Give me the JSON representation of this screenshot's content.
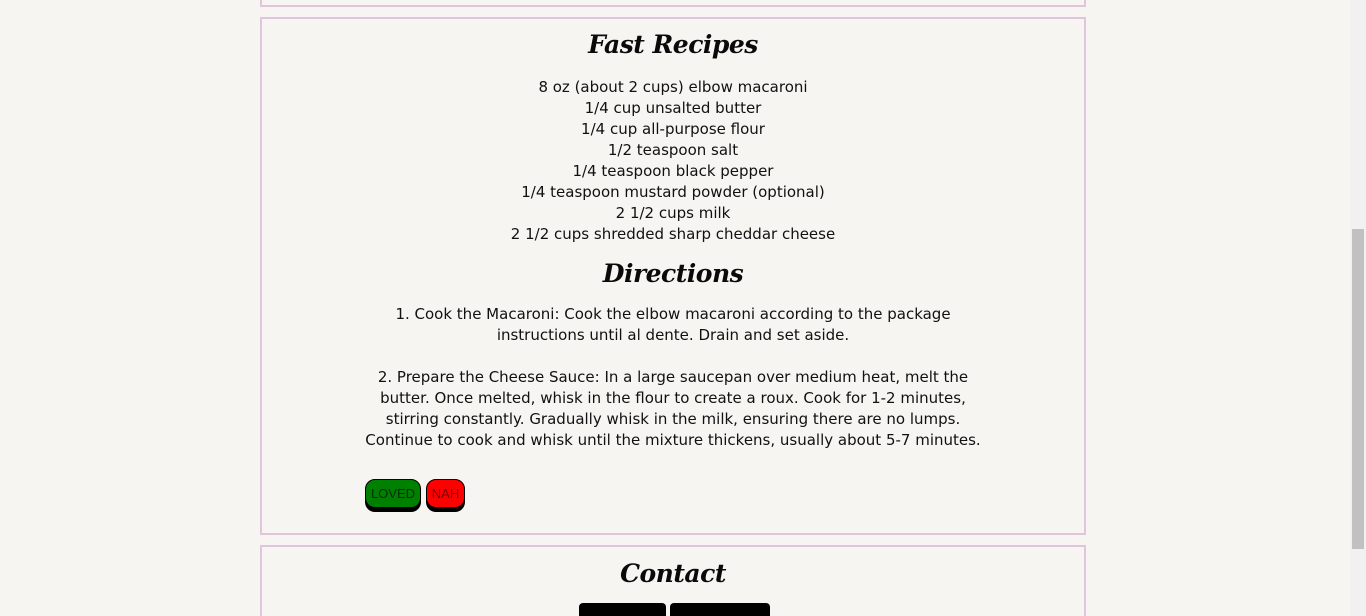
{
  "recipe": {
    "title": "Fast Recipes",
    "ingredients": [
      "8 oz (about 2 cups) elbow macaroni",
      "1/4 cup unsalted butter",
      "1/4 cup all-purpose flour",
      "1/2 teaspoon salt",
      "1/4 teaspoon black pepper",
      "1/4 teaspoon mustard powder (optional)",
      "2 1/2 cups milk",
      "2 1/2 cups shredded sharp cheddar cheese"
    ],
    "directions_title": "Directions",
    "directions": [
      "1. Cook the Macaroni: Cook the elbow macaroni according to the package instructions until al dente. Drain and set aside.",
      "2. Prepare the Cheese Sauce: In a large saucepan over medium heat, melt the butter. Once melted, whisk in the flour to create a roux. Cook for 1-2 minutes, stirring constantly. Gradually whisk in the milk, ensuring there are no lumps. Continue to cook and whisk until the mixture thickens, usually about 5-7 minutes."
    ],
    "loved_label": "LOVED",
    "nah_label": "NAH"
  },
  "contact": {
    "title": "Contact"
  },
  "colors": {
    "card_border": "#e2c4dc",
    "background": "#f6f5f2",
    "loved": "#008000",
    "nah": "#ff0000"
  }
}
